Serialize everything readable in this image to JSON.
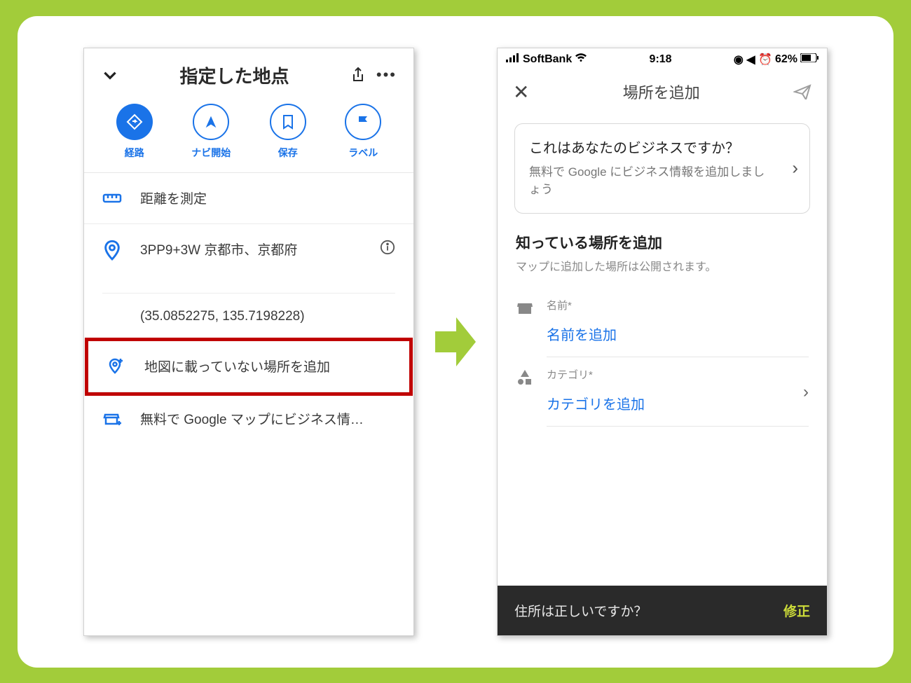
{
  "left": {
    "title": "指定した地点",
    "actions": {
      "route": "経路",
      "nav": "ナビ開始",
      "save": "保存",
      "label": "ラベル"
    },
    "measure": "距離を測定",
    "pluscode": "3PP9+3W 京都市、京都府",
    "coords": "(35.0852275, 135.7198228)",
    "add_place": "地図に載っていない場所を追加",
    "biz_row": "無料で Google マップにビジネス情…"
  },
  "right": {
    "status": {
      "carrier": "SoftBank",
      "time": "9:18",
      "battery": "62%"
    },
    "title": "場所を追加",
    "biz_card": {
      "title": "これはあなたのビジネスですか？",
      "sub": "無料で Google にビジネス情報を追加しましょう"
    },
    "section_title": "知っている場所を追加",
    "section_sub": "マップに追加した場所は公開されます。",
    "fields": {
      "name_label": "名前*",
      "name_placeholder": "名前を追加",
      "category_label": "カテゴリ*",
      "category_placeholder": "カテゴリを追加"
    },
    "snackbar": {
      "text": "住所は正しいですか？",
      "action": "修正"
    }
  }
}
